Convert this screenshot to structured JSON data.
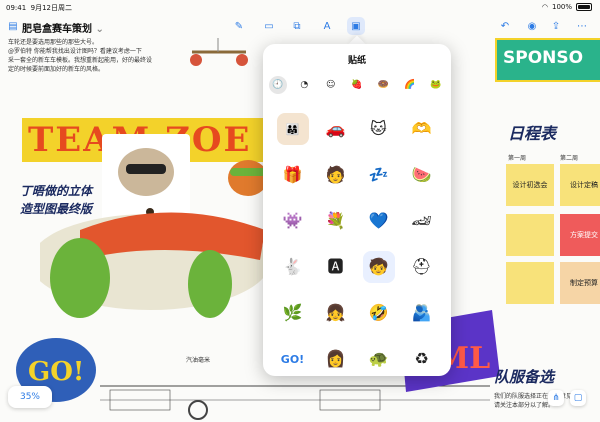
{
  "status": {
    "time": "09:41",
    "date": "9月12日周二",
    "battery": "100%"
  },
  "toolbar": {
    "title": "肥皂盒赛车策划",
    "chevron": "⌄"
  },
  "board": {
    "intro_lines": [
      "车轮还是要选用那些的那些大号。",
      "@罗伯特 你能帮我找出设计图吗？看建议考虑一下",
      "采一套全的新车车模板。我想重新起能用，好的最终设",
      "定的时候要前面加好的新车的风格。"
    ],
    "intro_link": "@罗伯特",
    "team_banner": "TEAM ZOE",
    "handwriting_note": [
      "丁晤做的立体",
      "造型图最终版"
    ],
    "car_caption": "汽油毫米",
    "sponsor": "SPONSO",
    "schedule_title": "日程表",
    "week1": "第一周",
    "week2": "第二周",
    "stickies_col1": [
      "设计初选会"
    ],
    "stickies_col2": [
      "设计定稿",
      "方案提交",
      "制定预算"
    ],
    "team_select": "队服备选",
    "team_select_note": [
      "我们的队服选择正在征求意见,",
      "请关注本部分以了解。"
    ],
    "zoom": "35%"
  },
  "popover": {
    "title": "贴纸",
    "categories": [
      {
        "icon": "clock-icon",
        "glyph": "🕘"
      },
      {
        "icon": "moon-icon",
        "glyph": "◔"
      },
      {
        "icon": "smiley-icon",
        "glyph": "☺"
      },
      {
        "icon": "strawberry-icon",
        "glyph": "🍓"
      },
      {
        "icon": "donut-icon",
        "glyph": "🍩"
      },
      {
        "icon": "rainbow-icon",
        "glyph": "🌈"
      },
      {
        "icon": "frog-icon",
        "glyph": "🐸"
      }
    ],
    "stickers": [
      {
        "name": "family-photo-sticker",
        "glyph": "👨‍👩‍👧",
        "bg": "#f4e4d0"
      },
      {
        "name": "red-car-sticker",
        "glyph": "🚗",
        "bg": "#ffffff"
      },
      {
        "name": "cat-sticker",
        "glyph": "🐱",
        "bg": "#ffffff"
      },
      {
        "name": "heart-hands-sticker",
        "glyph": "🫶",
        "bg": "#ffffff"
      },
      {
        "name": "gift-box-sticker",
        "glyph": "🎁",
        "bg": "#ffffff"
      },
      {
        "name": "memoji-sticker",
        "glyph": "🧑",
        "bg": "#ffffff"
      },
      {
        "name": "zzz-sticker",
        "glyph": "💤",
        "bg": "#ffffff"
      },
      {
        "name": "watermelon-sticker",
        "glyph": "🍉",
        "bg": "#ffffff"
      },
      {
        "name": "monster-sticker",
        "glyph": "👾",
        "bg": "#ffffff"
      },
      {
        "name": "flowers-sticker",
        "glyph": "💐",
        "bg": "#ffffff"
      },
      {
        "name": "blue-heart-sticker",
        "glyph": "💙",
        "bg": "#ffffff"
      },
      {
        "name": "race-car-sticker",
        "glyph": "🏎",
        "bg": "#ffffff"
      },
      {
        "name": "rabbit-sticker",
        "glyph": "🐇",
        "bg": "#ffffff"
      },
      {
        "name": "a-plus-sticker",
        "glyph": "🅰",
        "bg": "#ffffff"
      },
      {
        "name": "person-photo-sticker",
        "glyph": "🧒",
        "bg": "#e9f0ff"
      },
      {
        "name": "helmet-sticker",
        "glyph": "⛑",
        "bg": "#ffffff"
      },
      {
        "name": "monstera-leaf-sticker",
        "glyph": "🌿",
        "bg": "#ffffff"
      },
      {
        "name": "memoji-girl-sticker",
        "glyph": "👧",
        "bg": "#ffffff"
      },
      {
        "name": "laughing-emoji-sticker",
        "glyph": "🤣",
        "bg": "#ffffff"
      },
      {
        "name": "hug-photo-sticker",
        "glyph": "🫂",
        "bg": "#ffffff"
      },
      {
        "name": "go-sticker",
        "glyph": "GO!",
        "bg": "#ffffff"
      },
      {
        "name": "memoji-woman-sticker",
        "glyph": "👩",
        "bg": "#ffffff"
      },
      {
        "name": "turtle-sticker",
        "glyph": "🐢",
        "bg": "#ffffff"
      },
      {
        "name": "recycle-sticker",
        "glyph": "♻",
        "bg": "#ffffff"
      }
    ]
  },
  "colors": {
    "accent": "#2c7be5",
    "banner": "#f3d22a",
    "sponsor": "#2ab38b"
  }
}
